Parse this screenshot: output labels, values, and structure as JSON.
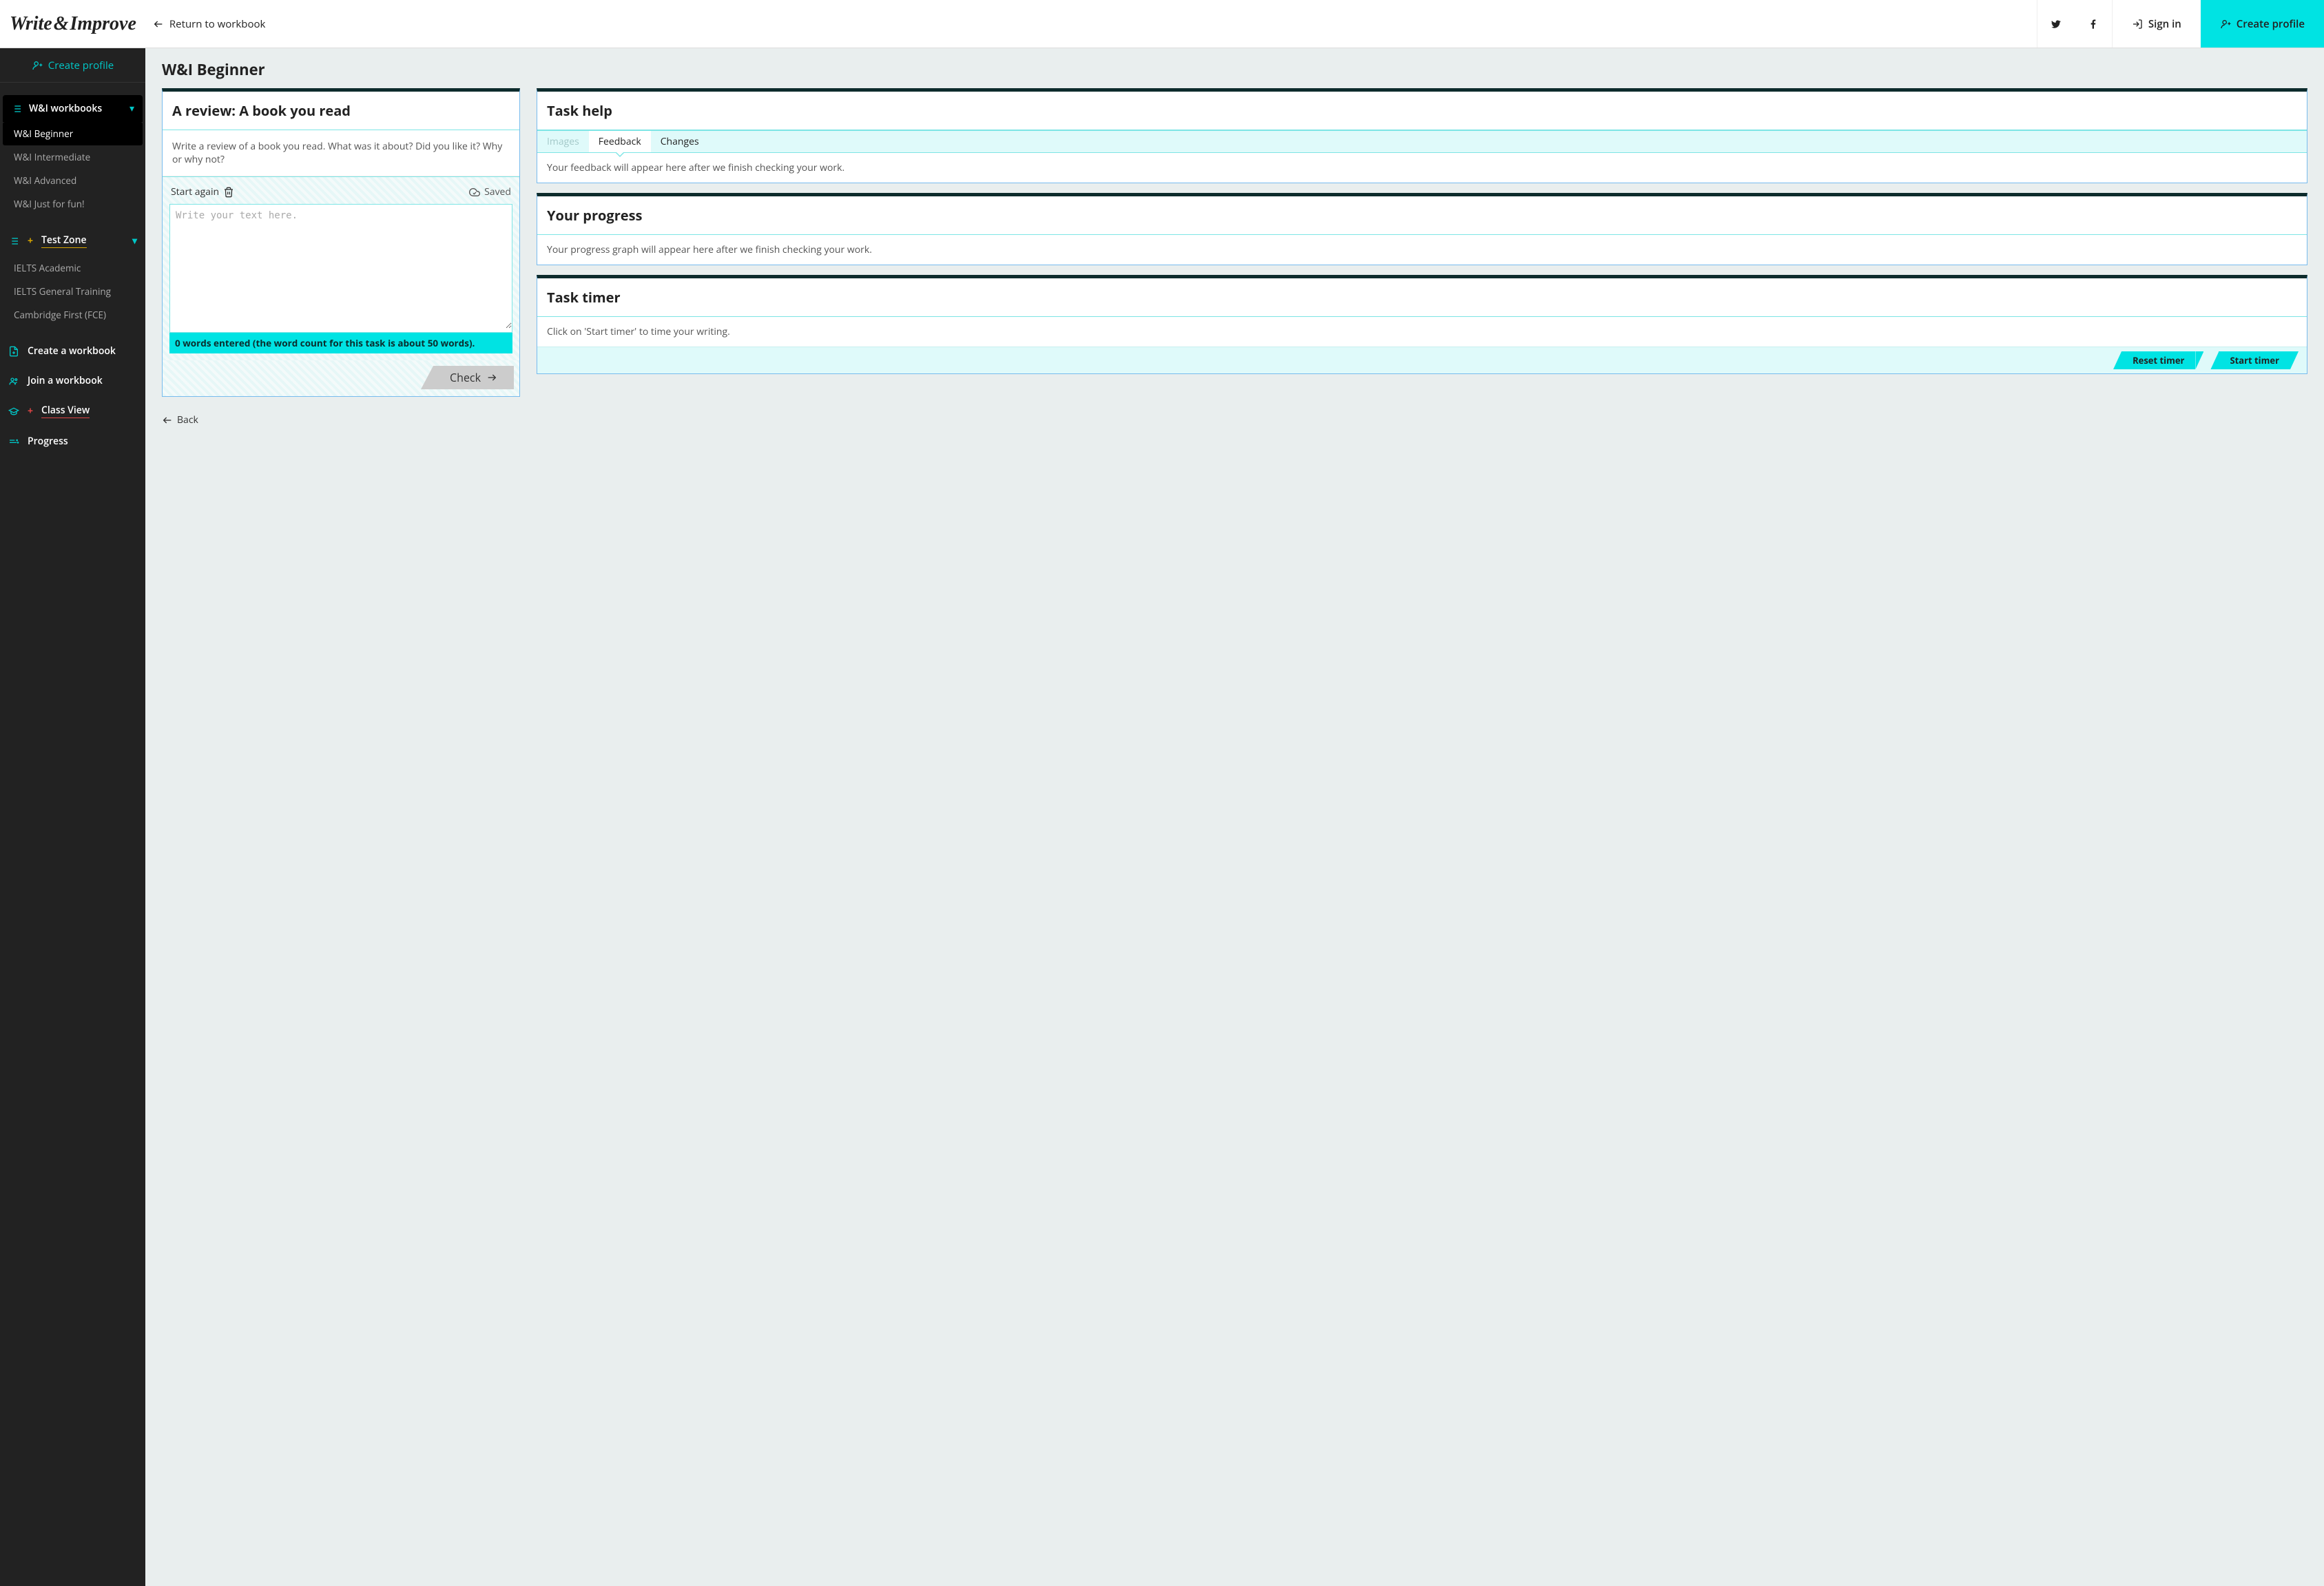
{
  "brand": {
    "part1": "Write",
    "amp": "&",
    "part2": "Improve"
  },
  "header": {
    "return": "Return to workbook",
    "signin": "Sign in",
    "create_profile": "Create profile"
  },
  "sidebar": {
    "create_profile": "Create profile",
    "groups": [
      {
        "label": "W&I workbooks",
        "items": [
          "W&I Beginner",
          "W&I Intermediate",
          "W&I Advanced",
          "W&I Just for fun!"
        ],
        "active_index": 0
      },
      {
        "label": "Test Zone",
        "items": [
          "IELTS Academic",
          "IELTS General Training",
          "Cambridge First (FCE)"
        ],
        "active_index": -1,
        "style": "yellow"
      }
    ],
    "links": {
      "create_workbook": "Create a workbook",
      "join_workbook": "Join a workbook",
      "class_view": "Class View",
      "progress": "Progress"
    }
  },
  "page": {
    "title": "W&I Beginner",
    "back": "Back"
  },
  "task": {
    "title": "A review: A book you read",
    "prompt": "Write a review of a book you read. What was it about? Did you like it? Why or why not?",
    "start_again": "Start again",
    "saved": "Saved",
    "placeholder": "Write your text here.",
    "word_bar": "0 words entered (the word count for this task is about 50 words).",
    "check": "Check"
  },
  "help": {
    "title": "Task help",
    "tabs": {
      "images": "Images",
      "feedback": "Feedback",
      "changes": "Changes"
    },
    "message": "Your feedback will appear here after we finish checking your work."
  },
  "progress_card": {
    "title": "Your progress",
    "message": "Your progress graph will appear here after we finish checking your work."
  },
  "timer": {
    "title": "Task timer",
    "message": "Click on 'Start timer' to time your writing.",
    "reset": "Reset timer",
    "start": "Start timer"
  }
}
